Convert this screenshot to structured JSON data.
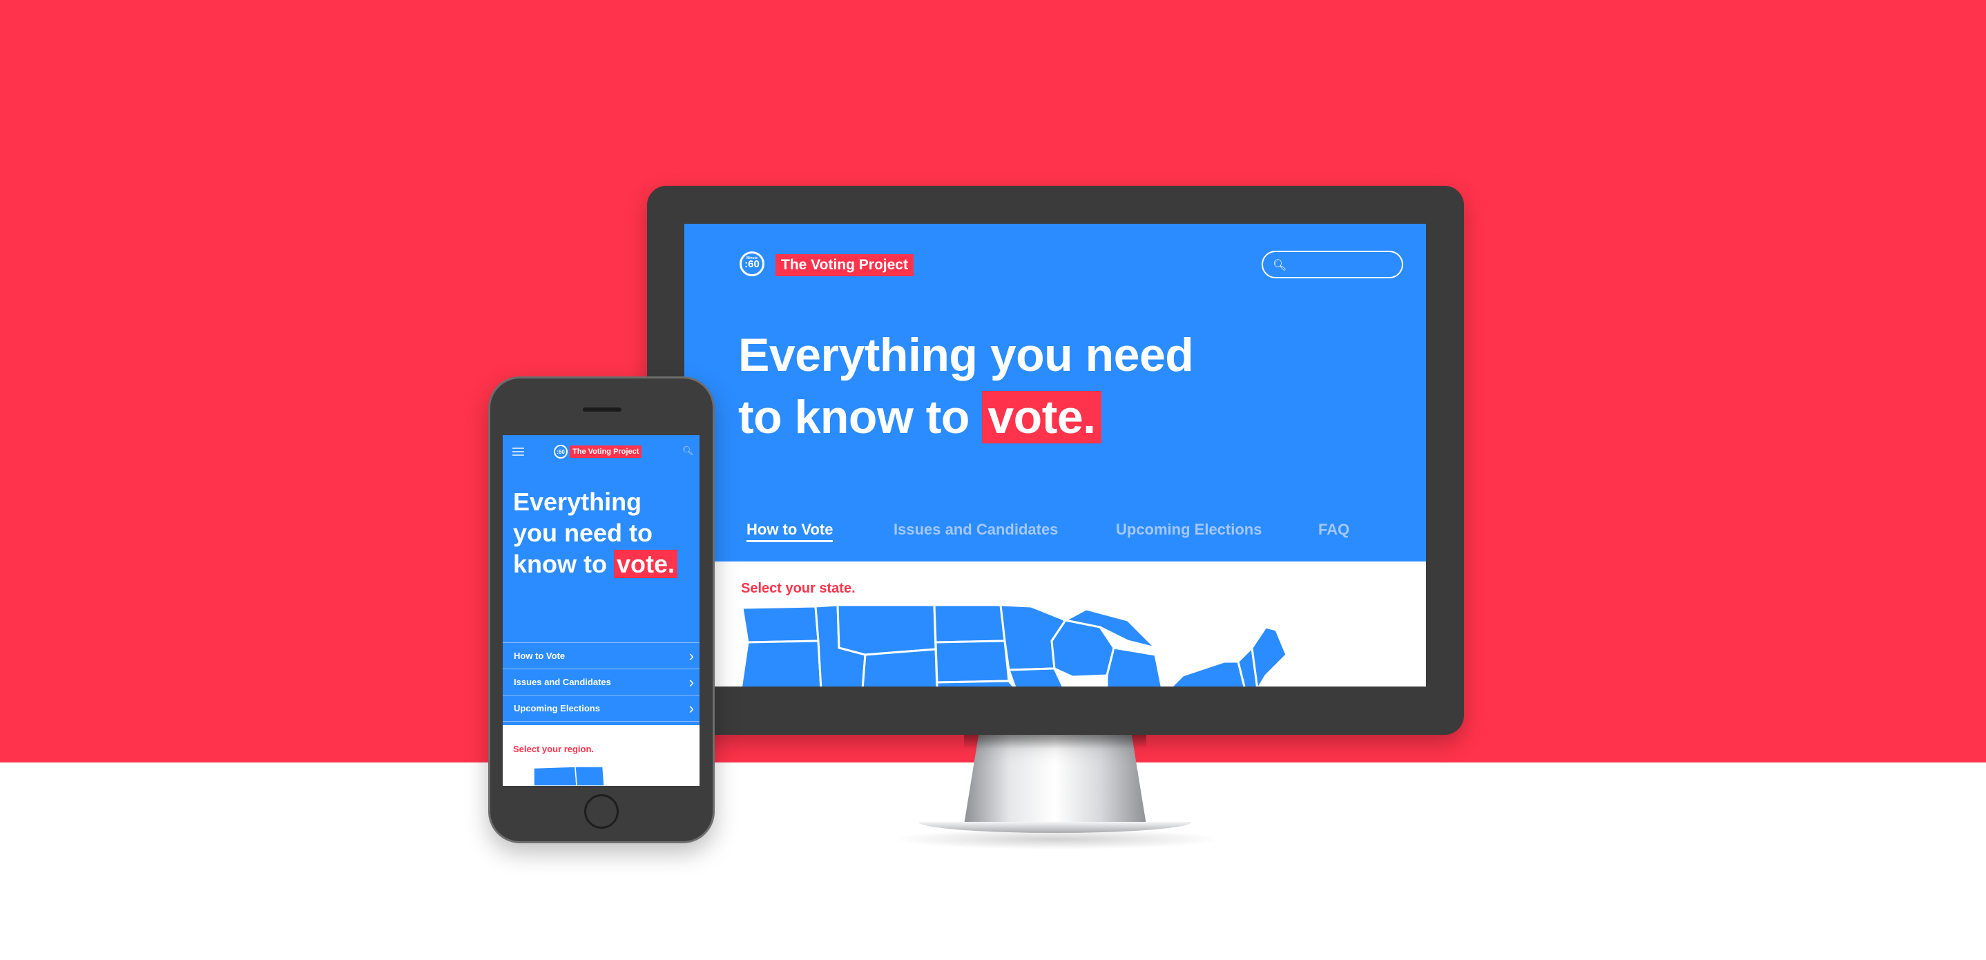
{
  "brand": {
    "logo_text": ":60",
    "logo_subtext": "Minute",
    "name": "The Voting Project",
    "colors": {
      "background": "#ff334b",
      "site_blue": "#2b8cff",
      "accent_red": "#ff334b"
    }
  },
  "desktop": {
    "search": {
      "placeholder": "",
      "icon": "search-icon"
    },
    "hero": {
      "line1": "Everything you need",
      "line2_prefix": "to know to",
      "highlight": "vote."
    },
    "nav": [
      {
        "label": "How to Vote",
        "active": true
      },
      {
        "label": "Issues and Candidates",
        "active": false
      },
      {
        "label": "Upcoming Elections",
        "active": false
      },
      {
        "label": "FAQ",
        "active": false
      }
    ],
    "select_prompt": "Select your state."
  },
  "mobile": {
    "menu_icon": "hamburger-icon",
    "search_icon": "search-icon",
    "hero": {
      "line1": "Everything",
      "line2": "you need to",
      "line3_prefix": "know to",
      "highlight": "vote."
    },
    "nav": [
      {
        "label": "How to Vote",
        "icon": "chevron-right-icon"
      },
      {
        "label": "Issues and Candidates",
        "icon": "chevron-right-icon"
      },
      {
        "label": "Upcoming Elections",
        "icon": "chevron-right-icon"
      }
    ],
    "select_prompt": "Select your region."
  }
}
